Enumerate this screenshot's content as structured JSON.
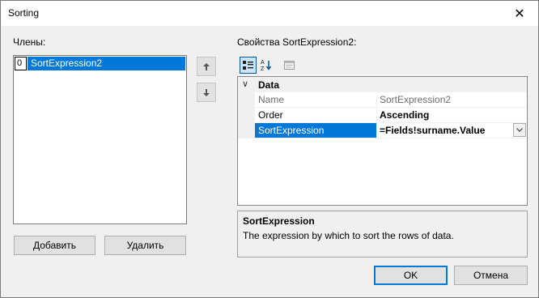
{
  "window": {
    "title": "Sorting",
    "close_glyph": "✕"
  },
  "members": {
    "label": "Члены:",
    "items": [
      {
        "index": "0",
        "name": "SortExpression2"
      }
    ]
  },
  "move_buttons": {
    "up_icon": "arrow-up-icon",
    "down_icon": "arrow-down-icon"
  },
  "buttons": {
    "add": "Добавить",
    "delete": "Удалить",
    "ok": "OK",
    "cancel": "Отмена"
  },
  "properties": {
    "label": "Свойства SortExpression2:",
    "toolbar": [
      "categorized-icon",
      "alphabetical-icon",
      "property-pages-icon"
    ],
    "category": {
      "name": "Data",
      "expanded_glyph": "∨"
    },
    "rows": [
      {
        "name": "Name",
        "value": "SortExpression2"
      },
      {
        "name": "Order",
        "value": "Ascending"
      },
      {
        "name": "SortExpression",
        "value": "=Fields!surname.Value"
      }
    ],
    "description": {
      "title": "SortExpression",
      "text": "The expression by which to sort the rows of data."
    }
  },
  "colors": {
    "selection": "#0078d7",
    "window_bg": "#f0f0f0"
  }
}
